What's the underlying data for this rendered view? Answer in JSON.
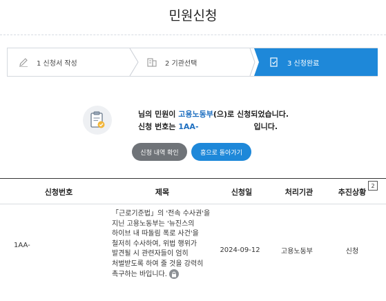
{
  "page": {
    "title": "민원신청"
  },
  "steps": [
    {
      "label": "1 신청서 작성",
      "icon": "pencil-icon",
      "active": false
    },
    {
      "label": "2 기관선택",
      "icon": "building-icon",
      "active": false
    },
    {
      "label": "3 신청완료",
      "icon": "document-check-icon",
      "active": true
    }
  ],
  "result": {
    "icon": "clipboard-check-icon",
    "line1_prefix": "님의 민원이 ",
    "agency": "고용노동부",
    "line1_suffix": "(으)로 신청되었습니다.",
    "line2_prefix": "신청 번호는 ",
    "number": "1AA-",
    "line2_suffix": "입니다."
  },
  "buttons": {
    "history": "신청 내역 확인",
    "home": "홈으로 돌아가기"
  },
  "table": {
    "headers": [
      "신청번호",
      "제목",
      "신청일",
      "처리기관",
      "추진상황"
    ],
    "badge": "2",
    "row": {
      "number": "1AA-",
      "subject": "「근로기준법」의 '전속 수사권'을 지닌 고용노동부는 '뉴진스의 하이브 내 따돌림 폭로 사건'을 철저히 수사하여, 위법 행위가 발견될 시 관련자들이 엄히 처벌받도록 하여 줄 것을 강력히 촉구하는 바입니다.",
      "date": "2024-09-12",
      "agency": "고용노동부",
      "status": "신청"
    }
  },
  "colors": {
    "accent": "#1e88d9",
    "grey_button": "#6f7378",
    "link_text": "#1e6fc0"
  }
}
